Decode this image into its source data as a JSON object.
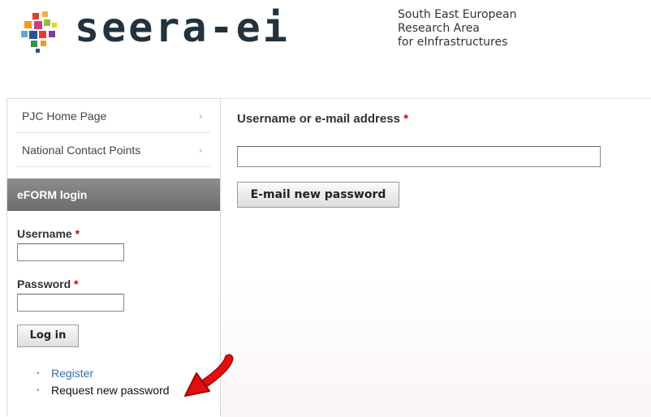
{
  "header": {
    "logo_text": "seera-ei",
    "tagline": [
      "South East European",
      "Research Area",
      "for eInfrastructures"
    ]
  },
  "sidebar": {
    "menu": [
      {
        "label": "PJC Home Page"
      },
      {
        "label": "National Contact Points"
      }
    ],
    "login_block": {
      "title": "eFORM login",
      "username_label": "Username",
      "password_label": "Password",
      "required_mark": "*",
      "username_value": "",
      "password_value": "",
      "login_button": "Log in",
      "links": [
        {
          "label": "Register"
        },
        {
          "label": "Request new password"
        }
      ]
    }
  },
  "main": {
    "field_label": "Username or e-mail address",
    "required_mark": "*",
    "field_value": "",
    "submit_button": "E-mail new password"
  },
  "colors": {
    "block_title_bg": "#7c7c7c",
    "link": "#2f6fb0",
    "required": "#cc0000",
    "annotation_arrow": "#e01010"
  }
}
